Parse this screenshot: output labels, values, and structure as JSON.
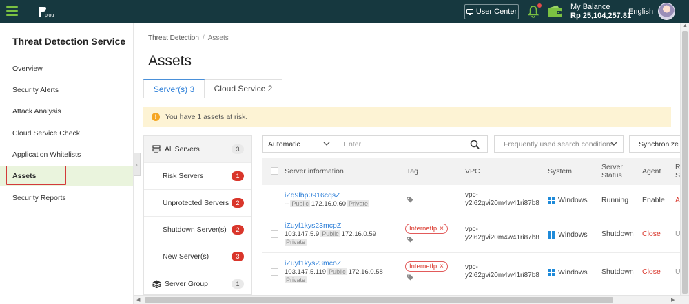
{
  "header": {
    "logo_text": "plou",
    "user_center": "User Center",
    "balance_label": "My Balance",
    "balance_value": "Rp 25,104,257.81",
    "language": "English",
    "accent": "#7bc142",
    "bg": "#16383f"
  },
  "sidebar": {
    "title": "Threat Detection Service",
    "items": [
      {
        "label": "Overview"
      },
      {
        "label": "Security Alerts"
      },
      {
        "label": "Attack Analysis"
      },
      {
        "label": "Cloud Service Check"
      },
      {
        "label": "Application Whitelists"
      },
      {
        "label": "Assets"
      },
      {
        "label": "Security Reports"
      }
    ],
    "active_index": 5
  },
  "breadcrumb": {
    "root": "Threat Detection",
    "separator": "/",
    "current": "Assets"
  },
  "page_title": "Assets",
  "tabs": [
    {
      "label": "Server(s) 3",
      "active": true
    },
    {
      "label": "Cloud Service 2",
      "active": false
    }
  ],
  "alert": {
    "icon": "!",
    "text": "You have 1 assets at risk."
  },
  "groups": {
    "all_servers": {
      "label": "All Servers",
      "count": "3"
    },
    "risk": {
      "label": "Risk Servers",
      "count": "1"
    },
    "unprotected": {
      "label": "Unprotected Servers",
      "count": "2"
    },
    "shutdown": {
      "label": "Shutdown Server(s)",
      "count": "2"
    },
    "new": {
      "label": "New Server(s)",
      "count": "3"
    },
    "server_group": {
      "label": "Server Group",
      "count": "1"
    }
  },
  "filters": {
    "mode": "Automatic",
    "search_placeholder": "Enter",
    "frequent_placeholder": "Frequently used search conditions",
    "sync_label": "Synchronize A"
  },
  "table": {
    "headers": {
      "server_info": "Server information",
      "tag": "Tag",
      "vpc": "VPC",
      "system": "System",
      "status_line1": "Server",
      "status_line2": "Status",
      "agent": "Agent",
      "risk_line1": "R",
      "risk_line2": "S"
    },
    "rows": [
      {
        "name": "iZq9lbp0916cqsZ",
        "public_ip": "--",
        "public_label": "Public",
        "private_ip": "172.16.0.60",
        "private_label": "Private",
        "tag": "",
        "vpc_line1": "vpc-",
        "vpc_line2": "y2l62gvi20m4w41ri87b8",
        "system": "Windows",
        "status": "Running",
        "agent": "Enable",
        "risk": "A"
      },
      {
        "name": "iZuyf1kys23mcpZ",
        "public_ip": "103.147.5.9",
        "public_label": "Public",
        "private_ip": "172.16.0.59",
        "private_label": "Private",
        "tag": "InternetIp",
        "vpc_line1": "vpc-",
        "vpc_line2": "y2l62gvi20m4w41ri87b8",
        "system": "Windows",
        "status": "Shutdown",
        "agent": "Close",
        "risk": "U"
      },
      {
        "name": "iZuyf1kys23mcoZ",
        "public_ip": "103.147.5.119",
        "public_label": "Public",
        "private_ip": "172.16.0.58",
        "private_label": "Private",
        "tag": "InternetIp",
        "vpc_line1": "vpc-",
        "vpc_line2": "y2l62gvi20m4w41ri87b8",
        "system": "Windows",
        "status": "Shutdown",
        "agent": "Close",
        "risk": "U"
      }
    ]
  }
}
